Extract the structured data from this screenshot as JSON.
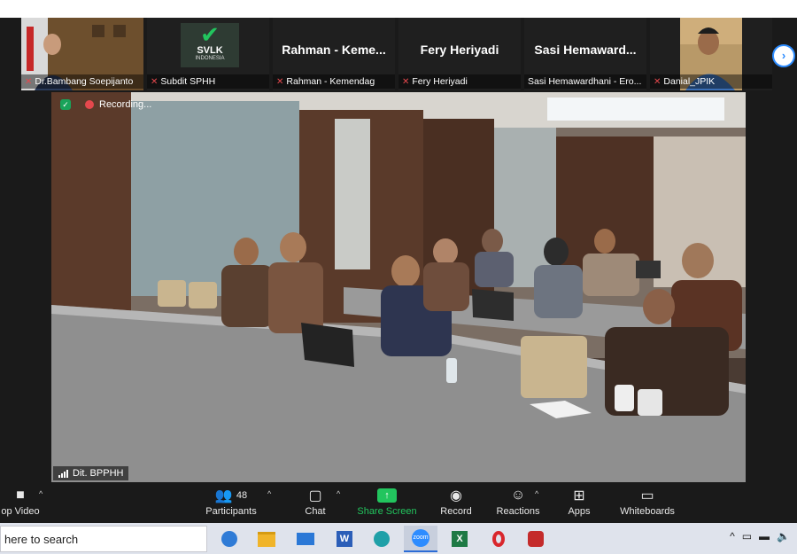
{
  "participants": [
    {
      "name": "Dr.Bambang Soepijanto",
      "muted": true,
      "has_video": true
    },
    {
      "name": "Subdit SPHH",
      "muted": true,
      "has_video": true,
      "logo_text": "SVLK",
      "logo_sub": "INDONESIA"
    },
    {
      "display": "Rahman - Keme...",
      "name": "Rahman - Kemendag",
      "muted": true,
      "has_video": false
    },
    {
      "display": "Fery Heriyadi",
      "name": "Fery Heriyadi",
      "muted": true,
      "has_video": false
    },
    {
      "display": "Sasi Hemaward...",
      "name": "Sasi Hemawardhani - Ero...",
      "muted": false,
      "has_video": false
    },
    {
      "name": "Danial_JPIK",
      "muted": true,
      "has_video": true
    }
  ],
  "main_video": {
    "speaker_label": "Dit. BPPHH",
    "recording_label": "Recording..."
  },
  "toolbar": {
    "stop_video": "op Video",
    "participants": "Participants",
    "participants_count": "48",
    "chat": "Chat",
    "share_screen": "Share Screen",
    "record": "Record",
    "reactions": "Reactions",
    "apps": "Apps",
    "whiteboards": "Whiteboards"
  },
  "taskbar": {
    "search_placeholder": "here to search",
    "apps": [
      "edge-icon",
      "file-explorer-icon",
      "mail-icon",
      "word-icon",
      "edge-new-icon",
      "zoom-icon",
      "excel-icon",
      "opera-icon",
      "app-icon"
    ]
  },
  "colors": {
    "accent": "#2d8cff",
    "share_green": "#22c55e",
    "muted_red": "#e5484d"
  }
}
